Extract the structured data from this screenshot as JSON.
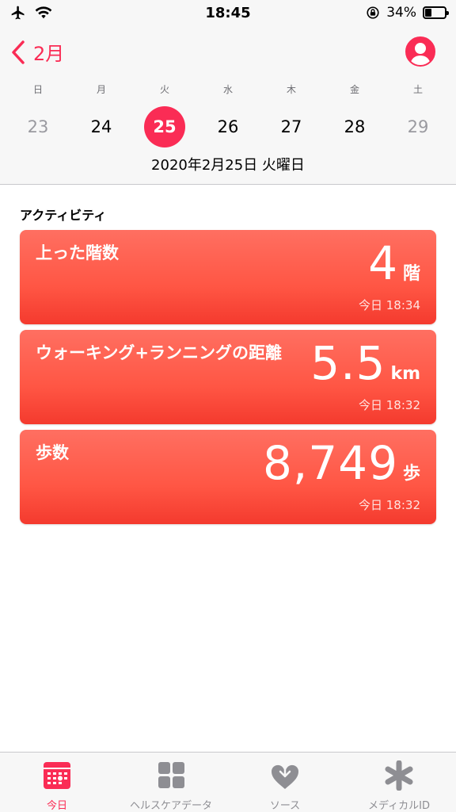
{
  "status_bar": {
    "time": "18:45",
    "battery": "34%",
    "battery_level": 0.34
  },
  "header": {
    "back_label": "2月",
    "weekdays": [
      "日",
      "月",
      "火",
      "水",
      "木",
      "金",
      "土"
    ],
    "dates": [
      "23",
      "24",
      "25",
      "26",
      "27",
      "28",
      "29"
    ],
    "selected_date": "25",
    "full_date": "2020年2月25日 火曜日"
  },
  "section": {
    "title": "アクティビティ"
  },
  "cards": [
    {
      "label": "上った階数",
      "value": "4",
      "unit": "階",
      "time": "今日 18:34"
    },
    {
      "label": "ウォーキング+ランニングの距離",
      "value": "5.5",
      "unit": "km",
      "time": "今日 18:32"
    },
    {
      "label": "歩数",
      "value": "8,749",
      "unit": "歩",
      "time": "今日 18:32"
    }
  ],
  "tabs": [
    {
      "label": "今日",
      "icon": "today-icon",
      "active": true
    },
    {
      "label": "ヘルスケアデータ",
      "icon": "grid-icon",
      "active": false
    },
    {
      "label": "ソース",
      "icon": "heart-download-icon",
      "active": false
    },
    {
      "label": "メディカルID",
      "icon": "asterisk-icon",
      "active": false
    }
  ],
  "colors": {
    "accent": "#fa2c55",
    "card": "#ff5644"
  }
}
